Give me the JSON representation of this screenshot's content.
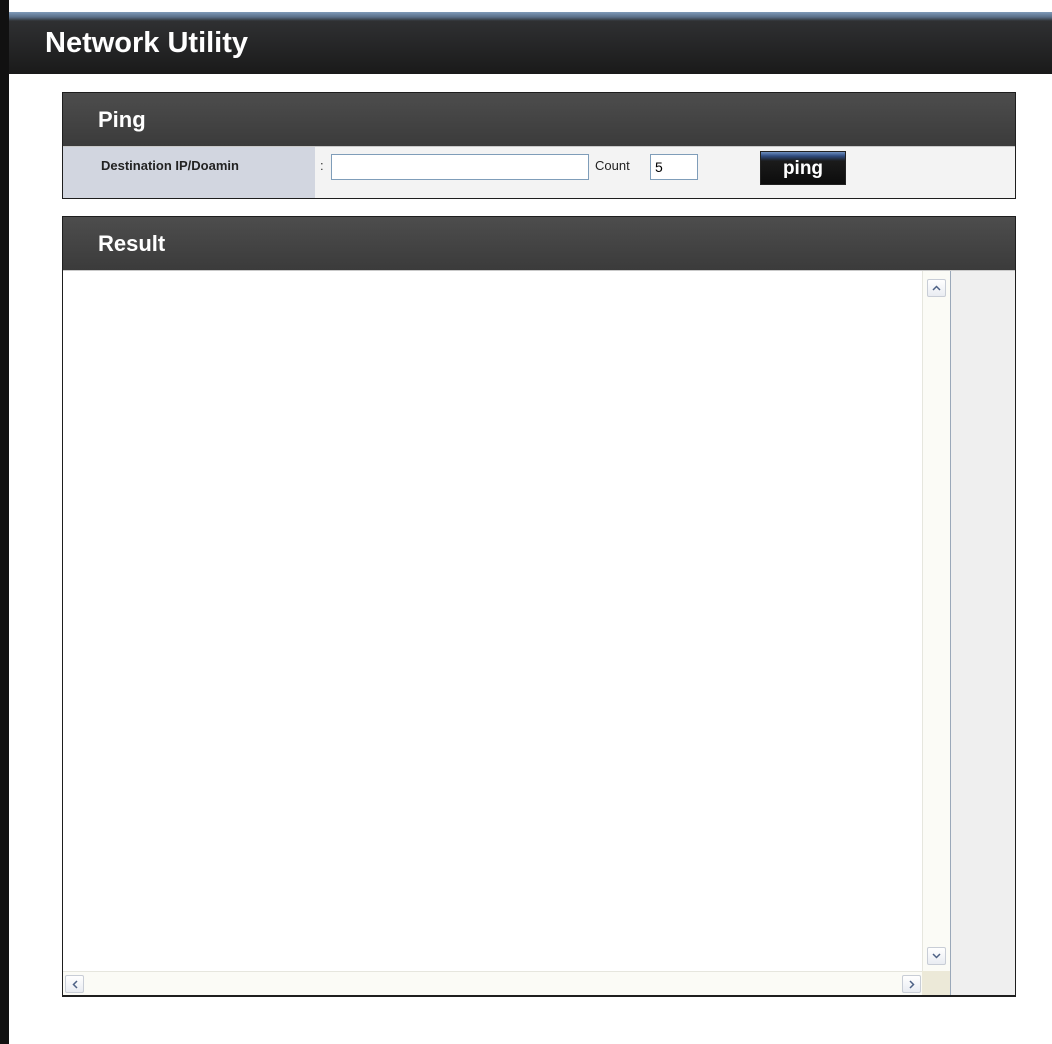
{
  "header": {
    "title": "Network Utility"
  },
  "ping": {
    "section_title": "Ping",
    "destination_label": "Destination IP/Doamin",
    "colon": ":",
    "destination_value": "",
    "count_label": "Count",
    "count_value": "5",
    "button_label": "ping"
  },
  "result": {
    "section_title": "Result",
    "output": ""
  },
  "colors": {
    "header_bg": "#1a1a1a",
    "panel_header_bg": "#444444",
    "label_cell_bg": "#d2d6e0",
    "row_bg": "#f3f3f3",
    "input_border": "#7f9db9"
  },
  "icons": {
    "scroll_up": "chevron-up-icon",
    "scroll_down": "chevron-down-icon",
    "scroll_left": "chevron-left-icon",
    "scroll_right": "chevron-right-icon"
  }
}
